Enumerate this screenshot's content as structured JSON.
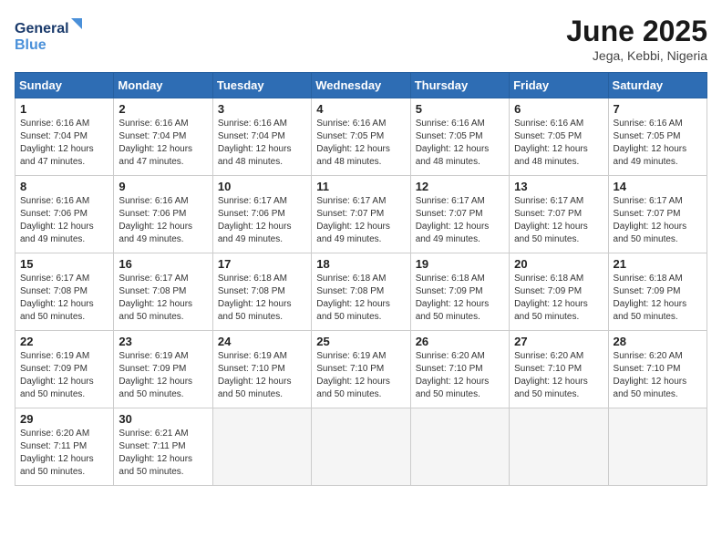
{
  "logo": {
    "line1": "General",
    "line2": "Blue"
  },
  "title": "June 2025",
  "location": "Jega, Kebbi, Nigeria",
  "days_of_week": [
    "Sunday",
    "Monday",
    "Tuesday",
    "Wednesday",
    "Thursday",
    "Friday",
    "Saturday"
  ],
  "weeks": [
    [
      {
        "day": 1,
        "sunrise": "6:16 AM",
        "sunset": "7:04 PM",
        "daylight": "12 hours and 47 minutes."
      },
      {
        "day": 2,
        "sunrise": "6:16 AM",
        "sunset": "7:04 PM",
        "daylight": "12 hours and 47 minutes."
      },
      {
        "day": 3,
        "sunrise": "6:16 AM",
        "sunset": "7:04 PM",
        "daylight": "12 hours and 48 minutes."
      },
      {
        "day": 4,
        "sunrise": "6:16 AM",
        "sunset": "7:05 PM",
        "daylight": "12 hours and 48 minutes."
      },
      {
        "day": 5,
        "sunrise": "6:16 AM",
        "sunset": "7:05 PM",
        "daylight": "12 hours and 48 minutes."
      },
      {
        "day": 6,
        "sunrise": "6:16 AM",
        "sunset": "7:05 PM",
        "daylight": "12 hours and 48 minutes."
      },
      {
        "day": 7,
        "sunrise": "6:16 AM",
        "sunset": "7:05 PM",
        "daylight": "12 hours and 49 minutes."
      }
    ],
    [
      {
        "day": 8,
        "sunrise": "6:16 AM",
        "sunset": "7:06 PM",
        "daylight": "12 hours and 49 minutes."
      },
      {
        "day": 9,
        "sunrise": "6:16 AM",
        "sunset": "7:06 PM",
        "daylight": "12 hours and 49 minutes."
      },
      {
        "day": 10,
        "sunrise": "6:17 AM",
        "sunset": "7:06 PM",
        "daylight": "12 hours and 49 minutes."
      },
      {
        "day": 11,
        "sunrise": "6:17 AM",
        "sunset": "7:07 PM",
        "daylight": "12 hours and 49 minutes."
      },
      {
        "day": 12,
        "sunrise": "6:17 AM",
        "sunset": "7:07 PM",
        "daylight": "12 hours and 49 minutes."
      },
      {
        "day": 13,
        "sunrise": "6:17 AM",
        "sunset": "7:07 PM",
        "daylight": "12 hours and 50 minutes."
      },
      {
        "day": 14,
        "sunrise": "6:17 AM",
        "sunset": "7:07 PM",
        "daylight": "12 hours and 50 minutes."
      }
    ],
    [
      {
        "day": 15,
        "sunrise": "6:17 AM",
        "sunset": "7:08 PM",
        "daylight": "12 hours and 50 minutes."
      },
      {
        "day": 16,
        "sunrise": "6:17 AM",
        "sunset": "7:08 PM",
        "daylight": "12 hours and 50 minutes."
      },
      {
        "day": 17,
        "sunrise": "6:18 AM",
        "sunset": "7:08 PM",
        "daylight": "12 hours and 50 minutes."
      },
      {
        "day": 18,
        "sunrise": "6:18 AM",
        "sunset": "7:08 PM",
        "daylight": "12 hours and 50 minutes."
      },
      {
        "day": 19,
        "sunrise": "6:18 AM",
        "sunset": "7:09 PM",
        "daylight": "12 hours and 50 minutes."
      },
      {
        "day": 20,
        "sunrise": "6:18 AM",
        "sunset": "7:09 PM",
        "daylight": "12 hours and 50 minutes."
      },
      {
        "day": 21,
        "sunrise": "6:18 AM",
        "sunset": "7:09 PM",
        "daylight": "12 hours and 50 minutes."
      }
    ],
    [
      {
        "day": 22,
        "sunrise": "6:19 AM",
        "sunset": "7:09 PM",
        "daylight": "12 hours and 50 minutes."
      },
      {
        "day": 23,
        "sunrise": "6:19 AM",
        "sunset": "7:09 PM",
        "daylight": "12 hours and 50 minutes."
      },
      {
        "day": 24,
        "sunrise": "6:19 AM",
        "sunset": "7:10 PM",
        "daylight": "12 hours and 50 minutes."
      },
      {
        "day": 25,
        "sunrise": "6:19 AM",
        "sunset": "7:10 PM",
        "daylight": "12 hours and 50 minutes."
      },
      {
        "day": 26,
        "sunrise": "6:20 AM",
        "sunset": "7:10 PM",
        "daylight": "12 hours and 50 minutes."
      },
      {
        "day": 27,
        "sunrise": "6:20 AM",
        "sunset": "7:10 PM",
        "daylight": "12 hours and 50 minutes."
      },
      {
        "day": 28,
        "sunrise": "6:20 AM",
        "sunset": "7:10 PM",
        "daylight": "12 hours and 50 minutes."
      }
    ],
    [
      {
        "day": 29,
        "sunrise": "6:20 AM",
        "sunset": "7:11 PM",
        "daylight": "12 hours and 50 minutes."
      },
      {
        "day": 30,
        "sunrise": "6:21 AM",
        "sunset": "7:11 PM",
        "daylight": "12 hours and 50 minutes."
      },
      null,
      null,
      null,
      null,
      null
    ]
  ]
}
